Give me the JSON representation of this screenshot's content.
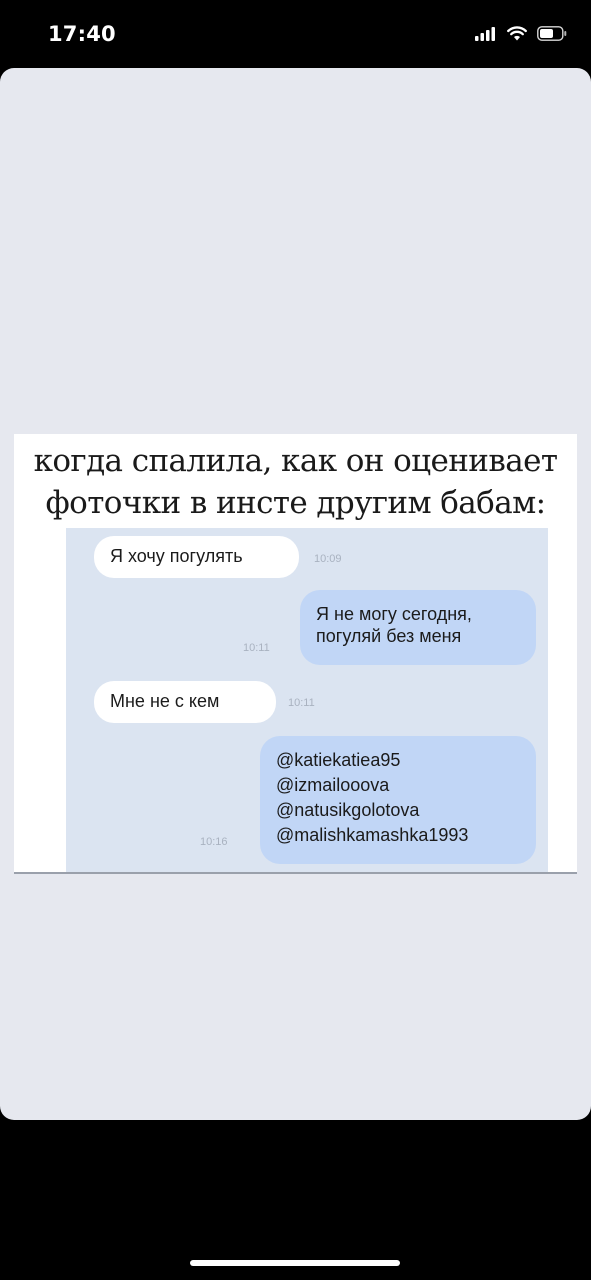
{
  "status_bar": {
    "time": "17:40"
  },
  "post": {
    "caption_line1": "когда спалила, как он оценивает",
    "caption_line2": "фоточки в инсте другим бабам:",
    "messages": [
      {
        "direction": "incoming",
        "text": "Я хочу погулять",
        "time": "10:09"
      },
      {
        "direction": "outgoing",
        "lines": [
          "Я не могу сегодня,",
          "погуляй без меня"
        ],
        "time": "10:11"
      },
      {
        "direction": "incoming",
        "text": "Мне не с кем",
        "time": "10:11"
      },
      {
        "direction": "outgoing",
        "lines": [
          "@katiekatiea95",
          "@izmailooova",
          "@natusikgolotova",
          "@malishkamashka1993"
        ],
        "time": "10:16"
      }
    ]
  },
  "colors": {
    "page_background": "#000000",
    "card_background": "#e6e8ef",
    "chat_background": "#dbe4f1",
    "incoming_bubble": "#ffffff",
    "outgoing_bubble": "#c1d6f6"
  },
  "icons": [
    "signal-icon",
    "wifi-icon",
    "battery-icon"
  ]
}
